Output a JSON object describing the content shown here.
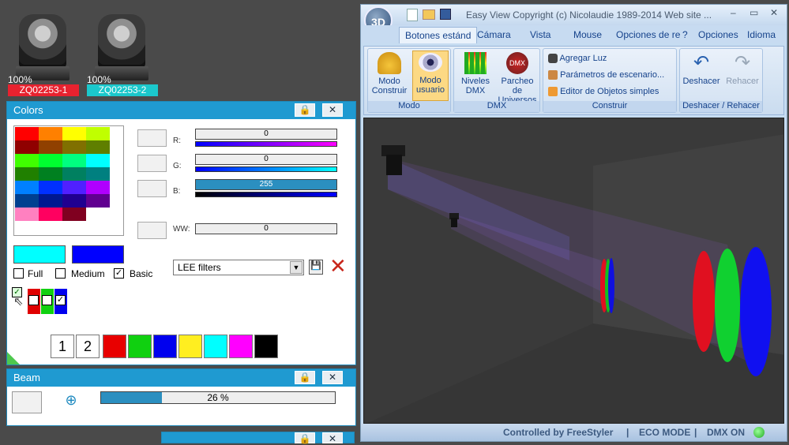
{
  "fixtures": [
    {
      "percent": "100%",
      "label": "ZQ02253-1",
      "color": "#e8222f"
    },
    {
      "percent": "100%",
      "label": "ZQ02253-2",
      "color": "#1bc8cc"
    }
  ],
  "colors_panel": {
    "title": "Colors",
    "swatches": [
      [
        "#ff0000",
        "#ff8000",
        "#ffff00",
        "#c0ff00"
      ],
      [
        "#900000",
        "#904000",
        "#807000",
        "#5f7f00"
      ],
      [
        "#40ff00",
        "#00ff30",
        "#00ff80",
        "#00ffff"
      ],
      [
        "#208000",
        "#008020",
        "#008060",
        "#008080"
      ],
      [
        "#0080ff",
        "#0030ff",
        "#5020ff",
        "#b000ff"
      ],
      [
        "#004090",
        "#001890",
        "#200090",
        "#600090"
      ],
      [
        "#ff80c0",
        "#ff0060",
        "#800020",
        "#ffffff"
      ]
    ],
    "channels": {
      "r_label": "R:",
      "r_value": "0",
      "g_label": "G:",
      "g_value": "0",
      "b_label": "B:",
      "b_value": "255",
      "ww_label": "WW:",
      "ww_value": "0"
    },
    "color_preview_a": "#00ffff",
    "color_preview_b": "#0000ff",
    "modes": {
      "full": "Full",
      "medium": "Medium",
      "basic": "Basic"
    },
    "filter_select": "LEE filters",
    "preset_numbers": [
      "1",
      "2"
    ],
    "preset_colors": [
      "#e80000",
      "#10d010",
      "#0000ee",
      "#ffee20",
      "#00ffff",
      "#ff00ff",
      "#000000"
    ]
  },
  "beam_panel": {
    "title": "Beam",
    "progress_label": "26 %",
    "progress_fraction": 0.26
  },
  "easy_view": {
    "title": "Easy View   Copyright (c) Nicolaudie 1989-2014   Web site ...",
    "logo": "3D",
    "tabs": [
      "Botones estánd",
      "Cámara",
      "Vista",
      "Mouse",
      "Opciones de re",
      "?",
      "Opciones",
      "Idioma"
    ],
    "groups": {
      "modo": {
        "label": "Modo",
        "construir": "Modo Construir",
        "usuario": "Modo usuario"
      },
      "dmx": {
        "label": "DMX",
        "niveles": "Niveles DMX",
        "parcheo": "Parcheo de Universos"
      },
      "construir": {
        "label": "Construir",
        "agregar": "Agregar Luz",
        "parametros": "Parámetros de escenario...",
        "editor": "Editor de Objetos simples"
      },
      "deshacer": {
        "label": "Deshacer / Rehacer",
        "deshacer": "Deshacer",
        "rehacer": "Rehacer"
      }
    },
    "status": {
      "controlled": "Controlled by FreeStyler",
      "eco": "ECO MODE",
      "dmx": "DMX ON"
    }
  }
}
